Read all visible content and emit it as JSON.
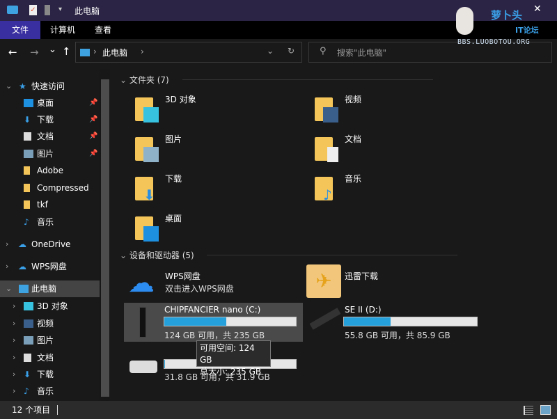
{
  "window": {
    "title": "此电脑",
    "close": "✕"
  },
  "watermark": {
    "line1": "萝卜头",
    "line2": "IT论坛",
    "line3": "BBS.LUOBOTOU.ORG"
  },
  "ribbon": {
    "tabs": [
      "文件",
      "计算机",
      "查看"
    ]
  },
  "nav": {
    "back": "←",
    "forward": "→",
    "recent": "⌄",
    "up": "↑",
    "breadcrumb": "此电脑",
    "search_placeholder": "搜索\"此电脑\""
  },
  "sidebar": {
    "quick_access": "快速访问",
    "quick_items": [
      "桌面",
      "下载",
      "文档",
      "图片",
      "Adobe",
      "Compressed",
      "tkf",
      "音乐"
    ],
    "onedrive": "OneDrive",
    "wps": "WPS网盘",
    "this_pc": "此电脑",
    "pc_items": [
      "3D 对象",
      "视频",
      "图片",
      "文档",
      "下载",
      "音乐"
    ]
  },
  "content": {
    "folders_header": "文件夹 (7)",
    "folders": [
      "3D 对象",
      "视频",
      "图片",
      "文档",
      "下载",
      "音乐",
      "桌面"
    ],
    "devices_header": "设备和驱动器 (5)",
    "wps": {
      "name": "WPS网盘",
      "sub": "双击进入WPS网盘"
    },
    "xunlei": {
      "name": "迅雷下载"
    },
    "drives": [
      {
        "name": "CHIPFANCIER nano (C:)",
        "info": "124 GB 可用，共 235 GB",
        "used_fraction": 0.47
      },
      {
        "name": "SE II (D:)",
        "info": "55.8 GB 可用，共 85.9 GB",
        "used_fraction": 0.35
      },
      {
        "name": "",
        "info": "31.8 GB 可用，共 31.9 GB",
        "used_fraction": 0.003
      }
    ],
    "tooltip": {
      "free": "可用空间: 124 GB",
      "total": "总大小: 235 GB"
    }
  },
  "status": {
    "count": "12 个项目"
  },
  "colors": {
    "accent": "#26a0da",
    "titlebar": "#2b2444",
    "file_tab": "#3a2fa0"
  }
}
